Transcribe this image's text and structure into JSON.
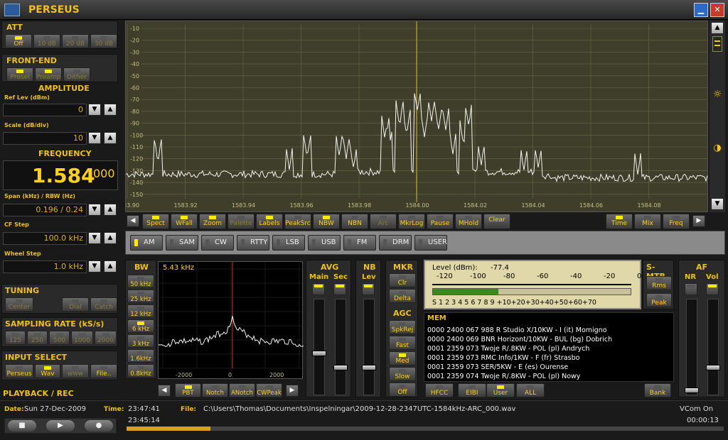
{
  "app": {
    "title": "PERSEUS"
  },
  "att": {
    "header": "ATT",
    "buttons": [
      "Off",
      "10 dB",
      "20 dB",
      "30 dB"
    ]
  },
  "frontend": {
    "header": "FRONT-END",
    "buttons": [
      "Presel",
      "Preamp",
      "Dither"
    ]
  },
  "amplitude": {
    "header": "AMPLITUDE",
    "ref_label": "Ref Lev (dBm)",
    "ref_value": "0",
    "scale_label": "Scale (dB/div)",
    "scale_value": "10"
  },
  "frequency": {
    "header": "FREQUENCY",
    "main": "1.584",
    "sub": "000",
    "span_label": "Span (kHz) / RBW (Hz)",
    "span_value": "0.196 / 0.24",
    "cf_label": "CF Step",
    "cf_value": "100.0 kHz",
    "wheel_label": "Wheel Step",
    "wheel_value": "1.0 kHz"
  },
  "tuning": {
    "header": "TUNING",
    "buttons": [
      "Center",
      "Dial",
      "Catch"
    ]
  },
  "sampling": {
    "header": "SAMPLING RATE (kS/s)",
    "buttons": [
      "125",
      "250",
      "500",
      "1000",
      "2000"
    ]
  },
  "input": {
    "header": "INPUT SELECT",
    "buttons": [
      "Perseus",
      "Wav",
      "www",
      "File.."
    ]
  },
  "playback": {
    "header": "PLAYBACK / REC"
  },
  "spectrum": {
    "yticks": [
      "-10",
      "-20",
      "-30",
      "-40",
      "-50",
      "-60",
      "-70",
      "-80",
      "-90",
      "-100",
      "-110",
      "-120",
      "-130",
      "-140",
      "-150"
    ],
    "xticks": [
      "1583.90",
      "1583.92",
      "1583.94",
      "1583.96",
      "1583.98",
      "1584.00",
      "1584.02",
      "1584.04",
      "1584.06",
      "1584.08"
    ]
  },
  "spec_buttons_left": [
    "Spect",
    "WFall",
    "Zoom",
    "Palette",
    "Labels",
    "PeakSrc",
    "NBW",
    "NBN",
    "Arc",
    "MkrLog",
    "Pause",
    "MHold",
    "Clear"
  ],
  "spec_buttons_right": [
    "Time",
    "Mix",
    "Freq"
  ],
  "modes": [
    "AM",
    "SAM",
    "CW",
    "RTTY",
    "LSB",
    "USB",
    "FM",
    "DRM",
    "USER"
  ],
  "bw": {
    "header": "BW",
    "buttons": [
      "50 kHz",
      "25 kHz",
      "12 kHz",
      "6 kHz",
      "3 kHz",
      "1.6kHz",
      "0.8kHz"
    ],
    "readout": "5.43 kHz",
    "xticks": [
      "-2000",
      "0",
      "2000"
    ],
    "buttons_bottom": [
      "PBT",
      "Notch",
      "ANotch",
      "CWPeak"
    ]
  },
  "avg": {
    "header": "AVG",
    "main": "Main",
    "sec": "Sec"
  },
  "nb": {
    "header": "NB",
    "lev": "Lev"
  },
  "mkr": {
    "header": "MKR",
    "buttons": [
      "Clr",
      "Delta"
    ]
  },
  "agc": {
    "header": "AGC",
    "buttons": [
      "SpkRej",
      "Fast",
      "Med",
      "Slow",
      "Off"
    ]
  },
  "smeter": {
    "level_label": "Level (dBm):",
    "level_value": "-77.4",
    "top": [
      "-120",
      "-100",
      "-80",
      "-60",
      "-40",
      "-20",
      "0"
    ],
    "bottom": "S  1  2  3  4  5  6  7  8  9  +10+20+30+40+50+60+70",
    "level_fraction": 0.33,
    "header": "S-MTR",
    "buttons": [
      "Rms",
      "Peak"
    ]
  },
  "mem": {
    "header": "MEM",
    "rows": [
      "0000 2400 067 988 R Studio X/10KW  - I (it)  Momigno",
      "0000 2400 069 BNR Horizont/10KW  - BUL (bg)  Dobrich",
      "0001 2359 073 Twoje R/.8KW  - POL (pl)  Andrych",
      "0001 2359 073 RMC Info/1KW  - F (fr)  Strasbo",
      "0001 2359 073 SER/5KW  - E (es)  Ourense",
      "0001 2359 074 Twoje R/.8KW  - POL (pl)  Nowy"
    ],
    "buttons": [
      "HFCC",
      "EIBI",
      "User",
      "ALL",
      "Bank"
    ]
  },
  "af": {
    "header": "AF",
    "nr": "NR",
    "vol": "Vol"
  },
  "status": {
    "date_label": "Date:",
    "date_value": "Sun 27-Dec-2009",
    "time_label": "Time:",
    "time_value": "23:47:41",
    "file_label": "File:",
    "file_value": "C:\\Users\\Thomas\\Documents\\Inspelningar\\2009-12-28-2347UTC-1584kHz-ARC_000.wav",
    "vcom": "VCom On",
    "pos_time": "23:45:14",
    "remaining": "00:00:13",
    "progress": 0.14
  }
}
